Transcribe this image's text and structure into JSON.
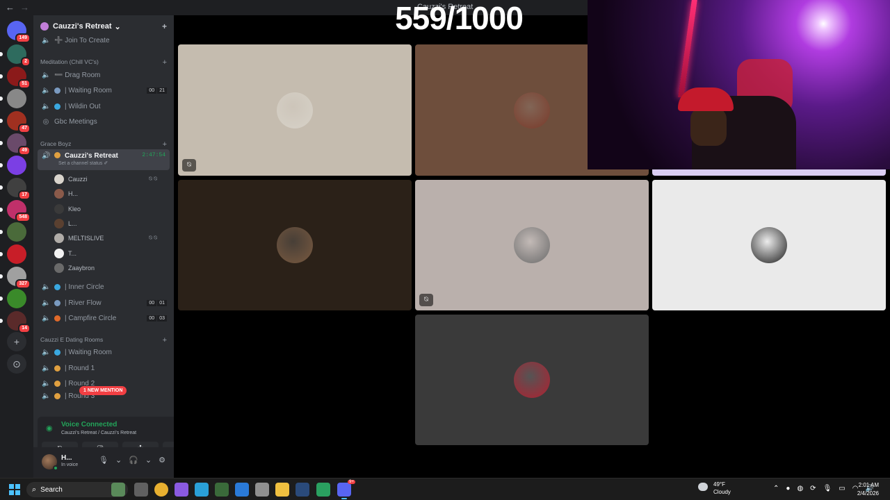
{
  "window": {
    "title": "Cauzzi's Retreat",
    "back": "←",
    "forward": "→"
  },
  "rail": {
    "servers": [
      {
        "name": "discord-home",
        "color": "#5865f2",
        "badge": "149"
      },
      {
        "name": "server-chi",
        "color": "#2e6b5e",
        "badge": "2"
      },
      {
        "name": "server-red",
        "color": "#8b1a1a",
        "badge": "51"
      },
      {
        "name": "server-person",
        "color": "#888888",
        "badge": ""
      },
      {
        "name": "server-car",
        "color": "#a03020",
        "badge": "47"
      },
      {
        "name": "server-art",
        "color": "#6a4a6a",
        "badge": "49"
      },
      {
        "name": "server-s",
        "color": "#7b3fe4",
        "badge": ""
      },
      {
        "name": "server-anime",
        "color": "#404040",
        "badge": "17"
      },
      {
        "name": "server-pink",
        "color": "#c0306a",
        "badge": "548"
      },
      {
        "name": "server-green-face",
        "color": "#4a6a3a",
        "badge": ""
      },
      {
        "name": "server-red-logo",
        "color": "#c81e28",
        "badge": ""
      },
      {
        "name": "server-voice-active",
        "color": "#a0a0a0",
        "badge": "327"
      },
      {
        "name": "server-green",
        "color": "#3a8a2a",
        "badge": ""
      },
      {
        "name": "server-dark",
        "color": "#5a2a2a",
        "badge": "14"
      }
    ],
    "add_label": "+",
    "discover_label": "⊙"
  },
  "sidebar": {
    "guild_name": "Cauzzi's Retreat",
    "guild_chevron": "⌄",
    "invite_icon": "+",
    "join_to_create": "➕ Join To Create",
    "cat_meditation": "Meditation (Chill VC's)",
    "drag_room": "➖ Drag Room",
    "waiting_room": "| Waiting Room",
    "waiting_room_tags": [
      "00",
      "21"
    ],
    "wildin_out": "| Wildin Out",
    "gbc_meetings": "Gbc Meetings",
    "cat_grace": "Grace Boyz",
    "active_channel": "Cauzzi's Retreat",
    "active_timer": "2:47:54",
    "set_status": "Set a channel status ✐",
    "members": [
      {
        "name": "Cauzzi",
        "color": "#d9d4cc",
        "icons": "⍉ ⍉"
      },
      {
        "name": "H...",
        "color": "#8a5a4a",
        "icons": ""
      },
      {
        "name": "Kleo",
        "color": "#3a3a3a",
        "icons": ""
      },
      {
        "name": "L...",
        "color": "#5a4030",
        "icons": ""
      },
      {
        "name": "MELTISLIVE",
        "color": "#b0aca8",
        "icons": "⍉ ⍉"
      },
      {
        "name": "T...",
        "color": "#f2f2f2",
        "icons": ""
      },
      {
        "name": "Zaaybron",
        "color": "#6a6a6a",
        "icons": ""
      }
    ],
    "inner_circle": "| Inner Circle",
    "river_flow": "| River Flow",
    "river_flow_tags": [
      "00",
      "01"
    ],
    "campfire_circle": "| Campfire Circle",
    "campfire_tags": [
      "00",
      "03"
    ],
    "cat_dating": "Cauzzi E Dating Rooms",
    "dating_waiting": "| Waiting Room",
    "round1": "| Round 1",
    "round2": "| Round 2",
    "round3": "| Round 3",
    "mention_pill": "1 NEW MENTION"
  },
  "voice": {
    "title": "Voice Connected",
    "subtitle": "Cauzzi's Retreat / Cauzzi's Retreat",
    "buttons": [
      "⍉",
      "⎚",
      "✣",
      "✧"
    ]
  },
  "user": {
    "name": "H...",
    "status": "In voice"
  },
  "main": {
    "counter": "559/1000",
    "tiles": [
      {
        "bg": "#c5bcaf",
        "avatar": "#d7d2c8",
        "camoff": true
      },
      {
        "bg": "#6e4e3c",
        "avatar": "#7a3a2a",
        "camoff": false
      },
      {
        "bg": "#2b2118",
        "avatar": "#7a5a40",
        "camoff": false
      },
      {
        "bg": "#bab0ac",
        "avatar": "#6a6a6a",
        "camoff": true
      },
      {
        "bg": "#eaeaea",
        "avatar": "#1a1a1a",
        "camoff": false
      },
      {
        "bg": "#3a3a3a",
        "avatar": "#b02030",
        "camoff": false
      }
    ]
  },
  "taskbar": {
    "search": "Search",
    "weather_temp": "49°F",
    "weather_cond": "Cloudy",
    "time": "2:01 AM",
    "date": "2/4/2026",
    "discord_badge": "9+"
  }
}
